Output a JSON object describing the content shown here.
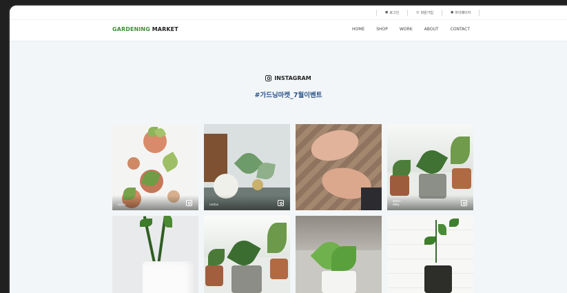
{
  "utility_nav": {
    "items": [
      {
        "icon": "person-icon",
        "label": "로그인"
      },
      {
        "icon": "member-icon",
        "label": "회원가입"
      },
      {
        "icon": "person-icon",
        "label": "마이페이지"
      }
    ]
  },
  "header": {
    "logo_green": "GARDENING",
    "logo_black": "MARKET",
    "menu": [
      "HOME",
      "SHOP",
      "WORK",
      "ABOUT",
      "CONTACT"
    ]
  },
  "instagram": {
    "title": "INSTAGRAM",
    "hashtag": "#가드닝마켓_7월이벤트"
  },
  "gallery": {
    "captions": [
      {
        "line1": "",
        "line2": "succu"
      },
      {
        "line1": "",
        "line2": "cactus"
      },
      {
        "line1": "",
        "line2": ""
      },
      {
        "line1": "water",
        "line2": "daily"
      }
    ]
  }
}
